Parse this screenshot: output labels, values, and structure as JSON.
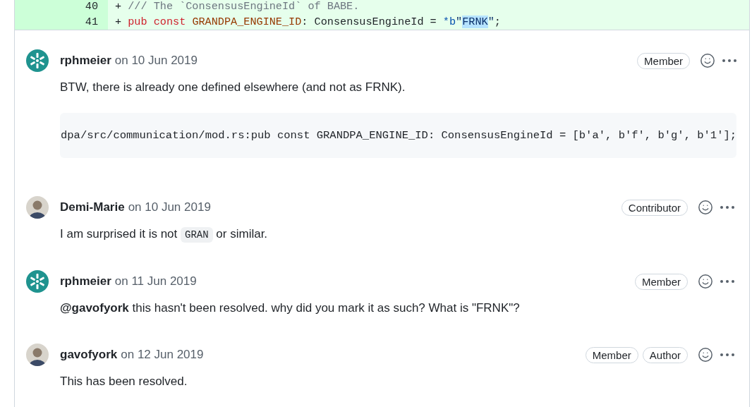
{
  "diff": {
    "lines": [
      {
        "number": "40",
        "marker": "+",
        "tokens": [
          {
            "kind": "comment",
            "text": "/// The `ConsensusEngineId` of BABE."
          }
        ]
      },
      {
        "number": "41",
        "marker": "+",
        "tokens": [
          {
            "kind": "keyword",
            "text": "pub const"
          },
          {
            "kind": "constant",
            "text": "GRANDPA_ENGINE_ID"
          },
          {
            "kind": "plain",
            "text": ": ConsensusEngineId = "
          },
          {
            "kind": "operator",
            "text": "*b"
          },
          {
            "kind": "string",
            "text": "\""
          },
          {
            "kind": "highlight",
            "text": "FRNK"
          },
          {
            "kind": "string",
            "text": "\""
          },
          {
            "kind": "plain",
            "text": ";"
          }
        ]
      }
    ]
  },
  "comments": [
    {
      "author": "rphmeier",
      "date": "on 10 Jun 2019",
      "avatar": {
        "kind": "identicon"
      },
      "badges": [
        "Member"
      ],
      "body": [
        {
          "kind": "paragraph",
          "parts": [
            {
              "kind": "text",
              "text": "BTW, there is already one defined elsewhere (and not as FRNK)."
            }
          ]
        },
        {
          "kind": "code_block",
          "text": "dpa/src/communication/mod.rs:pub const GRANDPA_ENGINE_ID: ConsensusEngineId = [b'a', b'f', b'g', b'1'];"
        }
      ]
    },
    {
      "author": "Demi-Marie",
      "date": "on 10 Jun 2019",
      "avatar": {
        "kind": "photo"
      },
      "badges": [
        "Contributor"
      ],
      "body": [
        {
          "kind": "paragraph",
          "parts": [
            {
              "kind": "text",
              "text": "I am surprised it is not "
            },
            {
              "kind": "code",
              "text": "GRAN"
            },
            {
              "kind": "text",
              "text": " or similar."
            }
          ]
        }
      ]
    },
    {
      "author": "rphmeier",
      "date": "on 11 Jun 2019",
      "avatar": {
        "kind": "identicon"
      },
      "badges": [
        "Member"
      ],
      "body": [
        {
          "kind": "paragraph",
          "parts": [
            {
              "kind": "text",
              "text": "**@gavofyork** this hasn't been resolved. why did you mark it as such? What is \"FRNK\"?"
            }
          ]
        }
      ]
    },
    {
      "author": "gavofyork",
      "date": "on 12 Jun 2019",
      "avatar": {
        "kind": "photo"
      },
      "badges": [
        "Member",
        "Author"
      ],
      "body": [
        {
          "kind": "paragraph",
          "parts": [
            {
              "kind": "text",
              "text": "This has been resolved."
            }
          ]
        }
      ]
    }
  ]
}
